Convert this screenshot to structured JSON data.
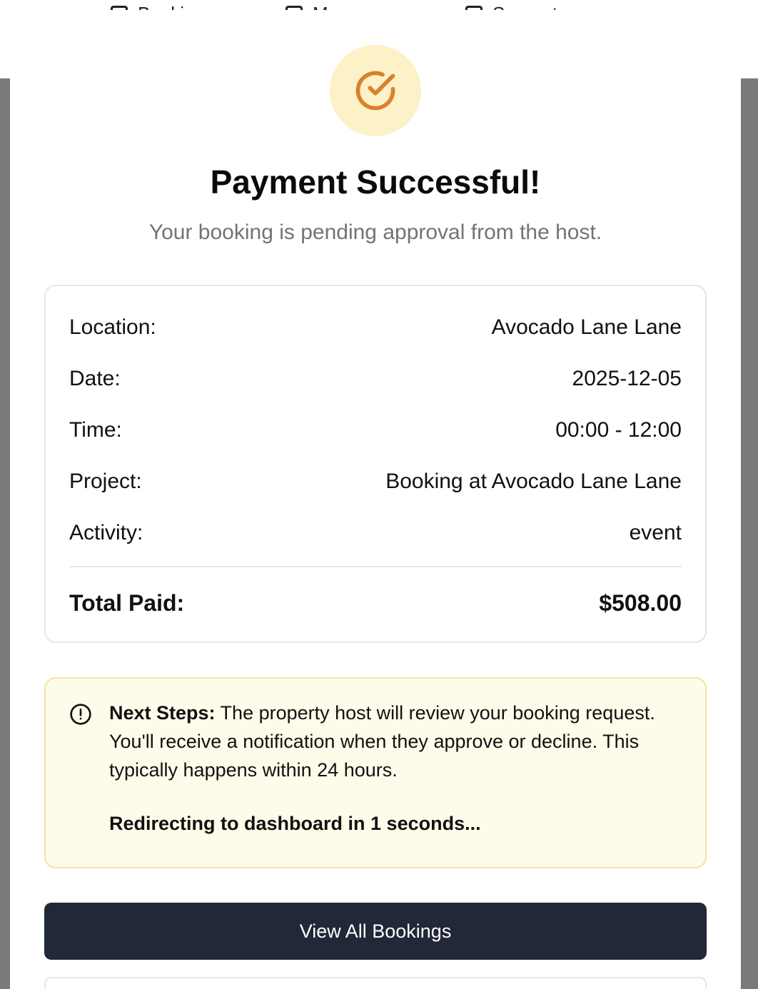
{
  "background_nav": {
    "items": [
      {
        "label": "Bookings",
        "icon": "calendar-icon"
      },
      {
        "label": "Messages",
        "icon": "message-icon"
      },
      {
        "label": "Support",
        "icon": "map-icon"
      }
    ]
  },
  "modal": {
    "icon": "check-circle-icon",
    "title": "Payment Successful!",
    "subtitle": "Your booking is pending approval from the host.",
    "details": [
      {
        "label": "Location:",
        "value": "Avocado Lane Lane"
      },
      {
        "label": "Date:",
        "value": "2025-12-05"
      },
      {
        "label": "Time:",
        "value": "00:00 - 12:00"
      },
      {
        "label": "Project:",
        "value": "Booking at Avocado Lane Lane"
      },
      {
        "label": "Activity:",
        "value": "event"
      }
    ],
    "total": {
      "label": "Total Paid:",
      "value": "$508.00"
    },
    "notice": {
      "icon": "info-circle-icon",
      "heading": "Next Steps:",
      "body": " The property host will review your booking request. You'll receive a notification when they approve or decline. This typically happens within 24 hours.",
      "redirect": "Redirecting to dashboard in 1 seconds..."
    },
    "primary_button": "View All Bookings"
  },
  "colors": {
    "accent_orange": "#d9822b",
    "icon_bg": "#fdf1c7",
    "notice_bg": "#fefbea",
    "notice_border": "#f4e3a0",
    "button_dark": "#212837",
    "overlay": "#7a7a7a"
  }
}
